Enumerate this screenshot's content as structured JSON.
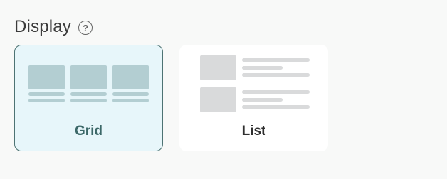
{
  "display": {
    "title": "Display",
    "help_icon": "question-circle-icon",
    "help_glyph": "?",
    "options": [
      {
        "id": "grid",
        "label": "Grid",
        "selected": true
      },
      {
        "id": "list",
        "label": "List",
        "selected": false
      }
    ]
  },
  "colors": {
    "selected_background": "#e7f6fa",
    "selected_border": "#4d7373",
    "selected_label": "#3c6868",
    "unselected_background": "#ffffff",
    "unselected_label": "#2f2f2f",
    "grid_preview": "#b3ced2",
    "list_preview": "#d9dadb"
  }
}
